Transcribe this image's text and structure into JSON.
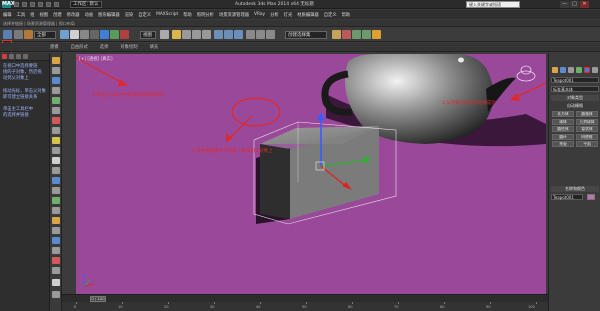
{
  "titlebar": {
    "app_logo": "MAX",
    "workspace": "工作区: 默认",
    "window_title": "Autodesk 3ds Max 2014 x64   无标题",
    "search_placeholder": "键入关键字或短语",
    "win_buttons": [
      "—",
      "□",
      "✕"
    ]
  },
  "menubar": {
    "items": [
      "编辑",
      "工具",
      "组",
      "视图",
      "创建",
      "修改器",
      "动画",
      "图形编辑器",
      "渲染",
      "自定义",
      "MAXScript",
      "帮助",
      "照明分析",
      "场景资源管理器",
      "VRay",
      "分析",
      "灯光",
      "材质编辑器",
      "自定义",
      "帮助"
    ]
  },
  "toolbar_hint": {
    "text": "选择并链接 | 场景资源管理器 | 视口布局"
  },
  "main_toolbar": {
    "filter": "全部",
    "view_mode": "视图",
    "selection_set": "创建选择集",
    "icons": [
      "undo-icon",
      "redo-icon",
      "select-link-icon",
      "unlink-icon",
      "bind-space-warp-icon",
      "selection-filter-icon",
      "select-object-icon",
      "select-by-name-icon",
      "rect-region-icon",
      "window-crossing-icon",
      "select-move-icon",
      "select-rotate-icon",
      "select-scale-icon",
      "reference-coord-icon",
      "pivot-icon",
      "snap-toggle-icon",
      "angle-snap-icon",
      "percent-snap-icon",
      "spinner-snap-icon",
      "named-selection-icon",
      "mirror-icon",
      "align-icon",
      "layer-manager-icon",
      "graphite-icon",
      "curve-editor-icon",
      "schematic-view-icon",
      "material-editor-icon",
      "render-setup-icon",
      "rendered-frame-icon",
      "render-icon"
    ]
  },
  "ribbon": {
    "tabs": [
      "建模",
      "自由形式",
      "选择",
      "对象绘制",
      "填充"
    ]
  },
  "scene_panel": {
    "notes": [
      "在视口中选择要链",
      "接的子对象，然后拖",
      "动到父对象上",
      "",
      "拖动光标，单击父对象",
      "即可建立链接关系",
      "",
      "单击主工具栏中",
      "的选择并链接"
    ]
  },
  "viewport": {
    "label": "[+] [透视] [真实]",
    "annotations": [
      "1.单击主工具栏中的选择并链接按钮",
      "2.选中要链接的子对象，拖动到父对象上",
      "3.父对象闪烁表示链接成功"
    ],
    "frame_label": "0 / 100"
  },
  "command_panel": {
    "tabs": [
      "create-tab",
      "modify-tab",
      "hierarchy-tab",
      "motion-tab",
      "display-tab",
      "utilities-tab"
    ],
    "object_type_select": "标准基本体",
    "object_type_header": "对象类型",
    "auto_grid": "自动栅格",
    "buttons": [
      "长方体",
      "圆锥体",
      "球体",
      "几何球体",
      "圆柱体",
      "管状体",
      "圆环",
      "四棱锥",
      "茶壶",
      "平面"
    ],
    "name_color_header": "名称和颜色",
    "name_value": "Teapot001",
    "color_accent": "#c46fb2"
  },
  "timeline": {
    "slider": "0 / 100",
    "ticks": [
      "0",
      "10",
      "20",
      "30",
      "40",
      "50",
      "60",
      "70",
      "80",
      "90",
      "100"
    ]
  },
  "colors": {
    "viewport_bg": "#9a499a",
    "annotation_red": "#e02828",
    "box_face": "#7b7b7b"
  }
}
